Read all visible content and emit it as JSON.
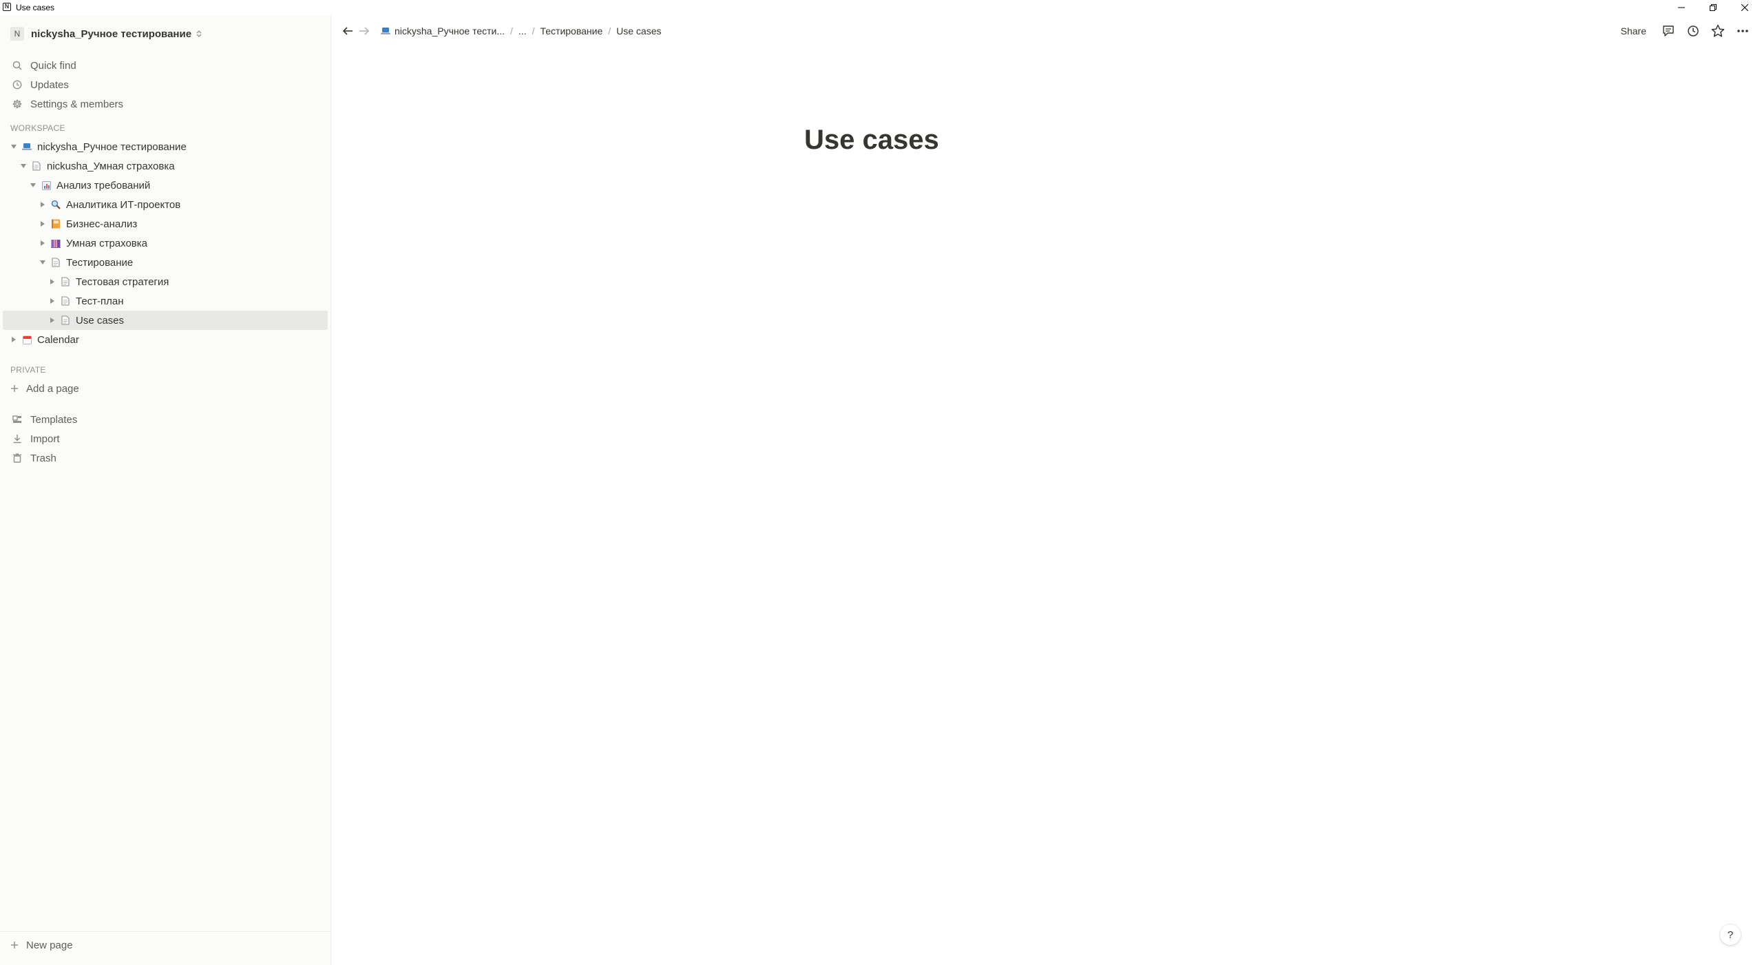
{
  "window": {
    "title": "Use cases"
  },
  "sidebar": {
    "workspace": {
      "avatar": "N",
      "name": "nickysha_Ручное тестирование"
    },
    "nav": [
      {
        "label": "Quick find",
        "icon": "search-icon"
      },
      {
        "label": "Updates",
        "icon": "clock-icon"
      },
      {
        "label": "Settings & members",
        "icon": "gear-icon"
      }
    ],
    "workspace_label": "WORKSPACE",
    "tree": [
      {
        "label": "nickysha_Ручное тестирование",
        "icon": "laptop-emoji-icon",
        "expanded": true
      },
      {
        "label": "nickusha_Умная страховка",
        "icon": "page-icon",
        "expanded": true
      },
      {
        "label": "Анализ требований",
        "icon": "chart-emoji-icon",
        "expanded": true
      },
      {
        "label": "Аналитика ИТ-проектов",
        "icon": "magnifier-emoji-icon",
        "expanded": false
      },
      {
        "label": "Бизнес-анализ",
        "icon": "notebook-emoji-icon",
        "expanded": false
      },
      {
        "label": "Умная страховка",
        "icon": "books-emoji-icon",
        "expanded": false
      },
      {
        "label": "Тестирование",
        "icon": "page-icon",
        "expanded": true
      },
      {
        "label": "Тестовая стратегия",
        "icon": "page-icon",
        "expanded": false
      },
      {
        "label": "Тест-план",
        "icon": "page-icon",
        "expanded": false
      },
      {
        "label": "Use cases",
        "icon": "page-icon",
        "expanded": false,
        "selected": true
      },
      {
        "label": "Calendar",
        "icon": "calendar-emoji-icon",
        "expanded": false
      }
    ],
    "private_label": "PRIVATE",
    "add_page": "Add a page",
    "tools": [
      {
        "label": "Templates",
        "icon": "templates-icon"
      },
      {
        "label": "Import",
        "icon": "download-icon"
      },
      {
        "label": "Trash",
        "icon": "trash-icon"
      }
    ],
    "new_page": "New page"
  },
  "topbar": {
    "breadcrumbs": [
      {
        "label": "nickysha_Ручное тести...",
        "icon": "laptop-emoji-icon"
      },
      {
        "label": "..."
      },
      {
        "label": "Тестирование"
      },
      {
        "label": "Use cases"
      }
    ],
    "share": "Share"
  },
  "page": {
    "title": "Use cases"
  },
  "help": "?",
  "colors": {
    "sidebar_bg": "#fbfbfa",
    "selected_bg": "#e8e8e6",
    "text": "#37352f",
    "muted": "#91918e"
  }
}
